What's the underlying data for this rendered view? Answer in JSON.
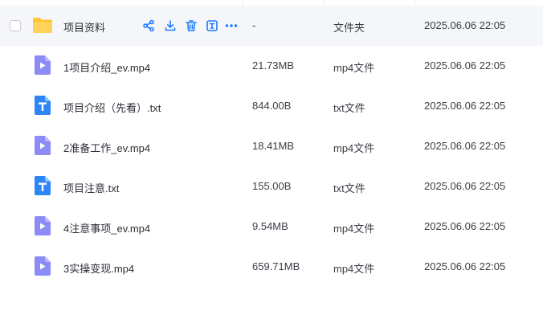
{
  "colors": {
    "accent": "#1e7cff",
    "video_icon": "#8c8cf7",
    "text_icon": "#2d86f3",
    "folder": "#ffc432",
    "row_hover": "#f4f6fa"
  },
  "row_actions": [
    {
      "name": "share-icon"
    },
    {
      "name": "download-icon"
    },
    {
      "name": "delete-icon"
    },
    {
      "name": "rename-icon"
    },
    {
      "name": "more-icon"
    }
  ],
  "files": [
    {
      "icon": "folder-icon",
      "name": "项目资料",
      "size": "-",
      "type": "文件夹",
      "modified": "2025.06.06 22:05",
      "hover": true
    },
    {
      "icon": "video-file-icon",
      "name": "1项目介绍_ev.mp4",
      "size": "21.73MB",
      "type": "mp4文件",
      "modified": "2025.06.06 22:05"
    },
    {
      "icon": "text-file-icon",
      "name": "项目介绍（先看）.txt",
      "size": "844.00B",
      "type": "txt文件",
      "modified": "2025.06.06 22:05"
    },
    {
      "icon": "video-file-icon",
      "name": "2准备工作_ev.mp4",
      "size": "18.41MB",
      "type": "mp4文件",
      "modified": "2025.06.06 22:05"
    },
    {
      "icon": "text-file-icon",
      "name": "项目注意.txt",
      "size": "155.00B",
      "type": "txt文件",
      "modified": "2025.06.06 22:05"
    },
    {
      "icon": "video-file-icon",
      "name": "4注意事项_ev.mp4",
      "size": "9.54MB",
      "type": "mp4文件",
      "modified": "2025.06.06 22:05"
    },
    {
      "icon": "video-file-icon",
      "name": "3实操变现.mp4",
      "size": "659.71MB",
      "type": "mp4文件",
      "modified": "2025.06.06 22:05"
    }
  ]
}
